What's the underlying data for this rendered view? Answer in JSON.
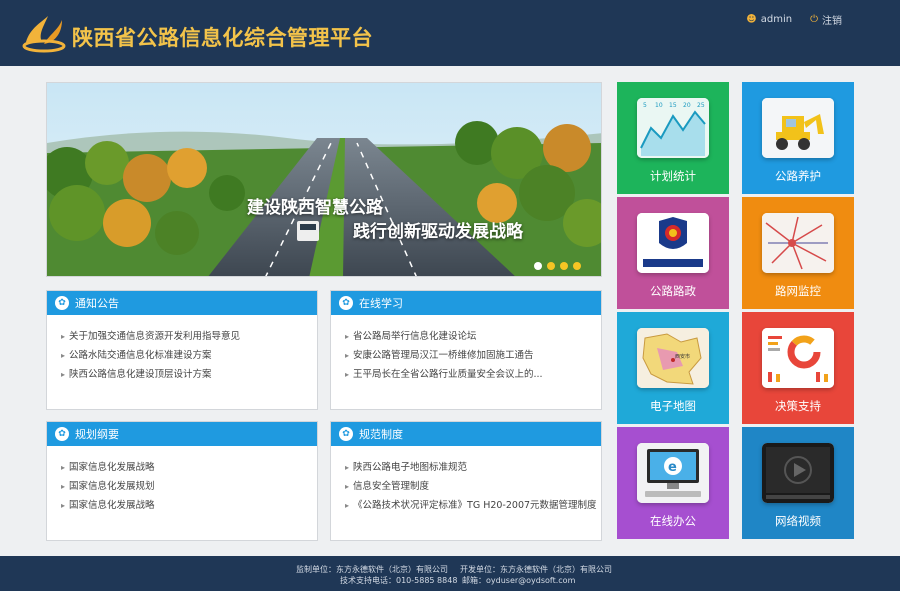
{
  "header": {
    "title": "陕西省公路信息化综合管理平台",
    "user": "admin",
    "logout": "注销"
  },
  "banner": {
    "slogan_line1": "建设陕西智慧公路",
    "slogan_line2": "践行创新驱动发展战略",
    "slide_count": 4,
    "active_slide": 1
  },
  "panels": {
    "notice": {
      "title": "通知公告",
      "items": [
        "关于加强交通信息资源开发利用指导意见",
        "公路水陆交通信息化标准建设方案",
        "陕西公路信息化建设顶层设计方案"
      ]
    },
    "learning": {
      "title": "在线学习",
      "items": [
        "省公路局举行信息化建设论坛",
        "安康公路管理局汉江一桥维修加固施工通告",
        "王平局长在全省公路行业质量安全会议上的..."
      ]
    },
    "planning": {
      "title": "规划纲要",
      "items": [
        "国家信息化发展战略",
        "国家信息化发展规划",
        "国家信息化发展战略"
      ]
    },
    "standards": {
      "title": "规范制度",
      "items": [
        "陕西公路电子地图标准规范",
        "信息安全管理制度",
        "《公路技术状况评定标准》TG H20-2007元数据管理制度"
      ]
    }
  },
  "tiles": [
    {
      "label": "计划统计",
      "color": "#1db45b",
      "icon": "chart-icon"
    },
    {
      "label": "公路养护",
      "color": "#1f9ae0",
      "icon": "excavator-icon"
    },
    {
      "label": "公路路政",
      "color": "#c0509a",
      "icon": "badge-icon"
    },
    {
      "label": "路网监控",
      "color": "#f08c10",
      "icon": "network-map-icon"
    },
    {
      "label": "电子地图",
      "color": "#1fa9d8",
      "icon": "map-icon"
    },
    {
      "label": "决策支持",
      "color": "#e8463a",
      "icon": "pie-chart-icon"
    },
    {
      "label": "在线办公",
      "color": "#a64fd0",
      "icon": "computer-icon"
    },
    {
      "label": "网络视频",
      "color": "#1f86c6",
      "icon": "video-icon"
    }
  ],
  "chart_icon_ticks": [
    "5",
    "10",
    "15",
    "20",
    "25"
  ],
  "map_icon_label": "西安市",
  "footer": {
    "sponsor": "监制单位：东方永德软件（北京）有限公司",
    "developer": "开发单位：东方永德软件（北京）有限公司",
    "support": "技术支持电话：010-5885 8848",
    "email": "邮箱：oyduser@oydsoft.com"
  }
}
